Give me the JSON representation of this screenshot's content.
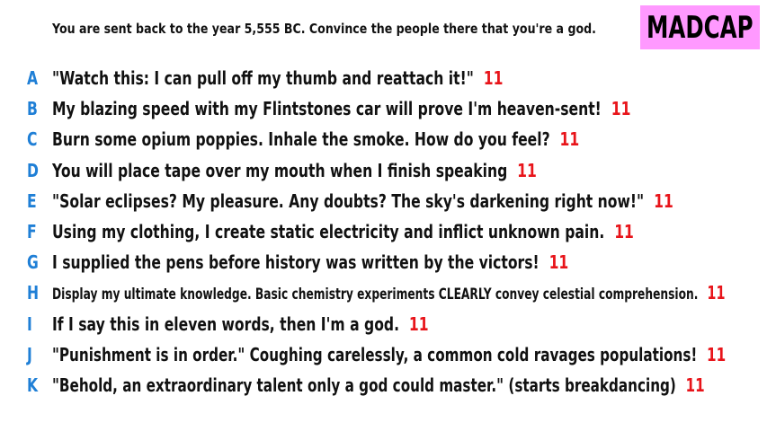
{
  "prompt": "You are sent back to the year 5,555 BC. Convince the people there that you're a god.",
  "brand": {
    "label": "MADCAP",
    "bg_color": "#ff99ff"
  },
  "colors": {
    "letter": "#1f7fd6",
    "score": "#e8141a",
    "text": "#111111"
  },
  "answers": [
    {
      "letter": "A",
      "text": "\"Watch this: I can pull off my thumb and reattach it!\"",
      "score": "11"
    },
    {
      "letter": "B",
      "text": "My blazing speed with my Flintstones car will prove I'm heaven-sent!",
      "score": "11"
    },
    {
      "letter": "C",
      "text": "Burn some opium poppies. Inhale the smoke. How do you feel?",
      "score": "11"
    },
    {
      "letter": "D",
      "text": "You will place tape over my mouth when I finish speaking",
      "score": "11"
    },
    {
      "letter": "E",
      "text": "\"Solar eclipses? My pleasure. Any doubts? The sky's darkening right now!\"",
      "score": "11"
    },
    {
      "letter": "F",
      "text": "Using my clothing, I create static electricity and inflict unknown pain.",
      "score": "11"
    },
    {
      "letter": "G",
      "text": "I supplied the pens before history was written by the victors!",
      "score": "11"
    },
    {
      "letter": "H",
      "text": "Display my ultimate knowledge. Basic chemistry experiments CLEARLY convey celestial comprehension.",
      "score": "11"
    },
    {
      "letter": "I",
      "text": "If I say this in eleven words, then I'm a god.",
      "score": "11"
    },
    {
      "letter": "J",
      "text": "\"Punishment is in order.\" Coughing carelessly, a common cold ravages populations!",
      "score": "11"
    },
    {
      "letter": "K",
      "text": "\"Behold, an extraordinary talent only a god could master.\" (starts breakdancing)",
      "score": "11"
    }
  ]
}
